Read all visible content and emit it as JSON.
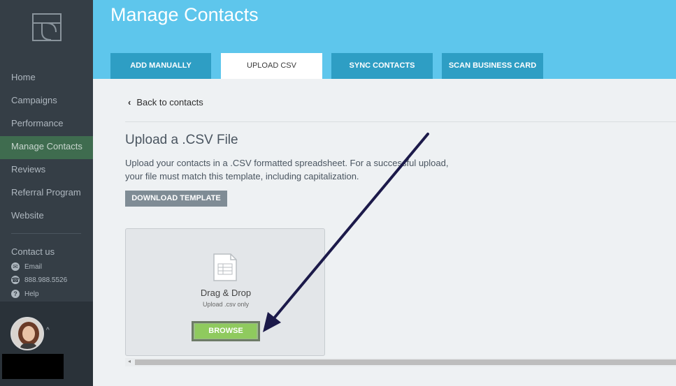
{
  "sidebar": {
    "nav": [
      {
        "label": "Home",
        "active": false
      },
      {
        "label": "Campaigns",
        "active": false
      },
      {
        "label": "Performance",
        "active": false
      },
      {
        "label": "Manage Contacts",
        "active": true
      },
      {
        "label": "Reviews",
        "active": false
      },
      {
        "label": "Referral Program",
        "active": false
      },
      {
        "label": "Website",
        "active": false
      }
    ],
    "contact_title": "Contact us",
    "email_label": "Email",
    "phone_label": "888.988.5526",
    "help_label": "Help"
  },
  "header": {
    "title": "Manage Contacts",
    "tabs": [
      {
        "label": "ADD MANUALLY",
        "active": false
      },
      {
        "label": "UPLOAD CSV",
        "active": true
      },
      {
        "label": "SYNC CONTACTS",
        "active": false
      },
      {
        "label": "SCAN BUSINESS CARD",
        "active": false
      }
    ]
  },
  "main": {
    "back_label": "Back to contacts",
    "section_title": "Upload a .CSV File",
    "description": "Upload your contacts in a .CSV formatted spreadsheet. For a successful upload, your file must match this template, including capitalization.",
    "download_button": "DOWNLOAD TEMPLATE",
    "dropzone": {
      "title": "Drag & Drop",
      "subtitle": "Upload .csv only",
      "browse_button": "BROWSE"
    }
  },
  "colors": {
    "sidebar_bg": "#353e46",
    "active_nav": "#3f6c4f",
    "header_bg": "#5ec6ec",
    "tab_bg": "#2e9ec4",
    "browse_green": "#8fca5e",
    "arrow": "#1c1a4a"
  },
  "icons": [
    "logo-icon",
    "email-icon",
    "phone-icon",
    "help-icon",
    "chevron-left-icon",
    "file-spreadsheet-icon",
    "caret-up-icon"
  ]
}
